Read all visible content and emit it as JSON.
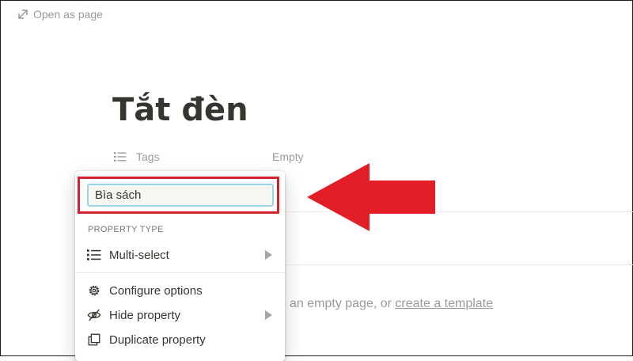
{
  "header": {
    "open_as_page_label": "Open as page"
  },
  "page": {
    "title": "Tắt đèn",
    "property": {
      "name": "Tags",
      "value": "Empty"
    },
    "empty_hint": {
      "text": "an empty page, or ",
      "link": "create a template"
    }
  },
  "property_menu": {
    "name_input_value": "Bìa sách",
    "section_label": "PROPERTY TYPE",
    "type_item": "Multi-select",
    "items": [
      {
        "label": "Configure options"
      },
      {
        "label": "Hide property"
      },
      {
        "label": "Duplicate property"
      }
    ]
  },
  "colors": {
    "highlight": "#d4202f",
    "arrow": "#e41e26",
    "input_border": "#9fd2e6"
  }
}
